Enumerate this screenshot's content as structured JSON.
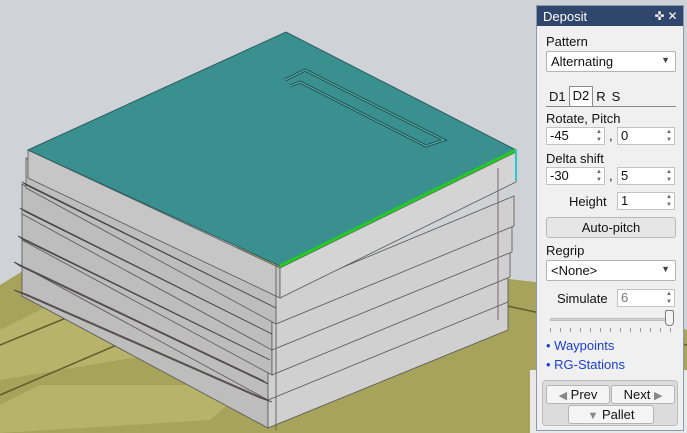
{
  "panel": {
    "title": "Deposit",
    "pin_icon": "pin-icon",
    "close_icon": "close-icon",
    "pattern_label": "Pattern",
    "pattern_value": "Alternating",
    "tabs": [
      {
        "label": "D1",
        "active": false
      },
      {
        "label": "D2",
        "active": true
      },
      {
        "label": "R",
        "active": false
      },
      {
        "label": "S",
        "active": false
      }
    ],
    "rotate_pitch_label": "Rotate, Pitch",
    "rotate_value": "-45",
    "pitch_value": "0",
    "delta_shift_label": "Delta shift",
    "delta_shift_x": "-30",
    "delta_shift_y": "5",
    "comma": ",",
    "height_label": "Height",
    "height_value": "1",
    "auto_pitch_label": "Auto-pitch",
    "regrip_label": "Regrip",
    "regrip_value": "<None>",
    "simulate_label": "Simulate",
    "simulate_value": "6",
    "simulate_slider_fraction": 1.0,
    "links": [
      {
        "label": "• Waypoints"
      },
      {
        "label": "• RG-Stations"
      }
    ],
    "prev_label": "Prev",
    "next_label": "Next",
    "pallet_label": "Pallet"
  },
  "colors": {
    "title_bar": "#31466d",
    "top_sheet": "#3a8f8f",
    "interleave_sheet": "#9c6e6a",
    "layer_side": "#c9c9c9",
    "floor": "#a7a35a",
    "highlight_edge": "#22cc22",
    "link": "#1b3fd0"
  }
}
